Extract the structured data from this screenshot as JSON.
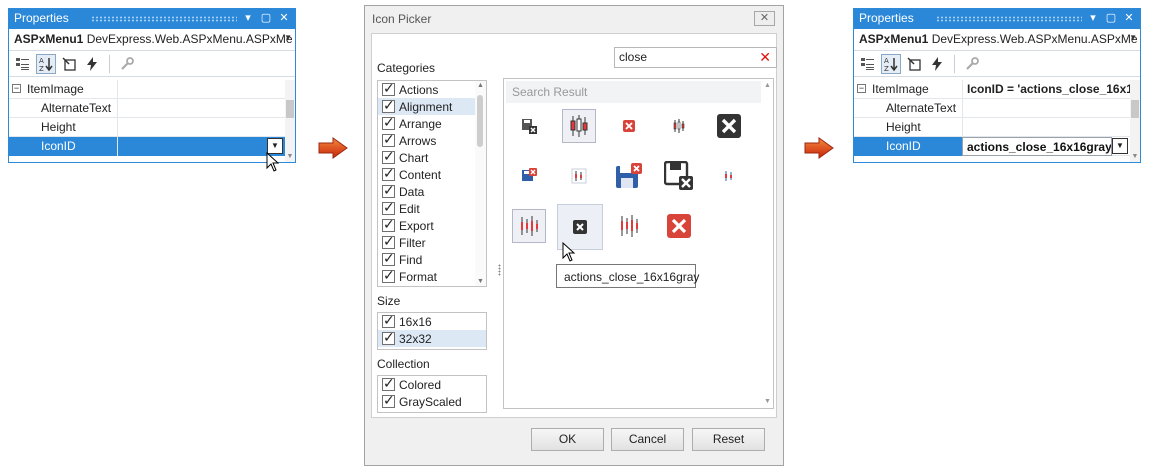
{
  "left_panel": {
    "title": "Properties",
    "object_name": "ASPxMenu1",
    "object_type": "DevExpress.Web.ASPxMenu.ASPxMe",
    "category": "ItemImage",
    "rows": [
      {
        "label": "AlternateText",
        "value": ""
      },
      {
        "label": "Height",
        "value": ""
      },
      {
        "label": "IconID",
        "value": ""
      }
    ]
  },
  "right_panel": {
    "title": "Properties",
    "object_name": "ASPxMenu1",
    "object_type": "DevExpress.Web.ASPxMenu.ASPxMe",
    "category": "ItemImage",
    "category_value": "IconID = 'actions_close_16x1",
    "rows": [
      {
        "label": "AlternateText",
        "value": ""
      },
      {
        "label": "Height",
        "value": ""
      },
      {
        "label": "IconID",
        "value": "actions_close_16x16gray"
      }
    ]
  },
  "picker": {
    "title": "Icon Picker",
    "search_value": "close",
    "categories_label": "Categories",
    "categories": [
      "Actions",
      "Alignment",
      "Arrange",
      "Arrows",
      "Chart",
      "Content",
      "Data",
      "Edit",
      "Export",
      "Filter",
      "Find",
      "Format"
    ],
    "size_label": "Size",
    "sizes": [
      "16x16",
      "32x32"
    ],
    "collection_label": "Collection",
    "collections": [
      "Colored",
      "GrayScaled"
    ],
    "results_header": "Search Result",
    "tooltip": "actions_close_16x16gray",
    "buttons": {
      "ok": "OK",
      "cancel": "Cancel",
      "reset": "Reset"
    }
  },
  "colors": {
    "accent": "#2b88d8",
    "arrow": "#d93a10",
    "close_red": "#d9443a"
  }
}
